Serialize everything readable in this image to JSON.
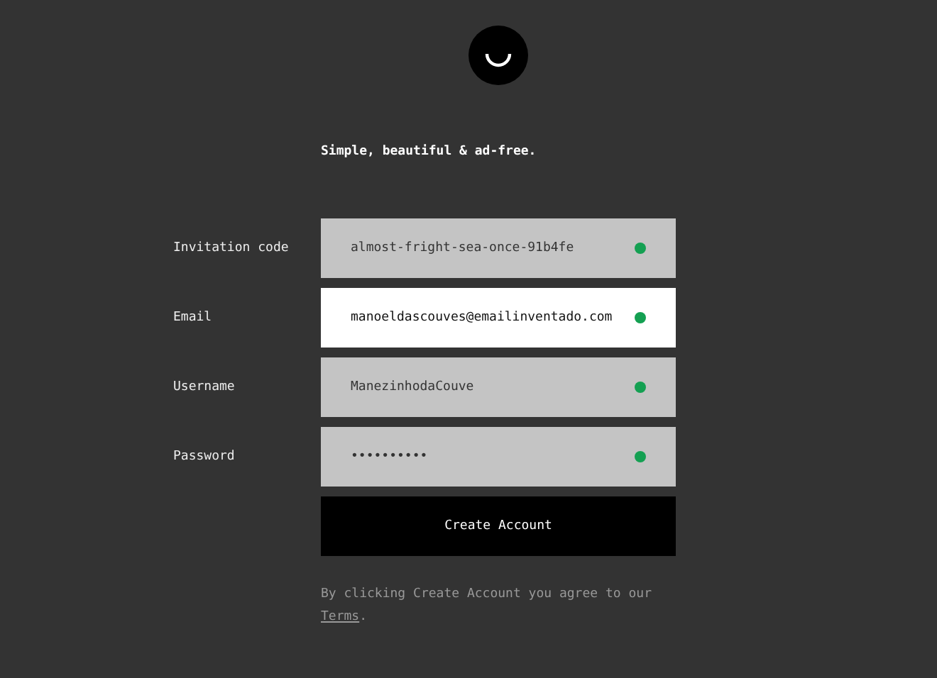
{
  "tagline": "Simple, beautiful & ad-free.",
  "fields": [
    {
      "label": "Invitation code",
      "value": "almost-fright-sea-once-91b4fe",
      "focused": false,
      "valid": true
    },
    {
      "label": "Email",
      "value": "manoeldascouves@emailinventado.com",
      "focused": true,
      "valid": true
    },
    {
      "label": "Username",
      "value": "ManezinhodaCouve",
      "focused": false,
      "valid": true
    },
    {
      "label": "Password",
      "value": "••••••••••",
      "focused": false,
      "valid": true
    }
  ],
  "submit": "Create Account",
  "terms": {
    "text": "By clicking Create Account you agree to our",
    "link": "Terms",
    "after": "."
  }
}
